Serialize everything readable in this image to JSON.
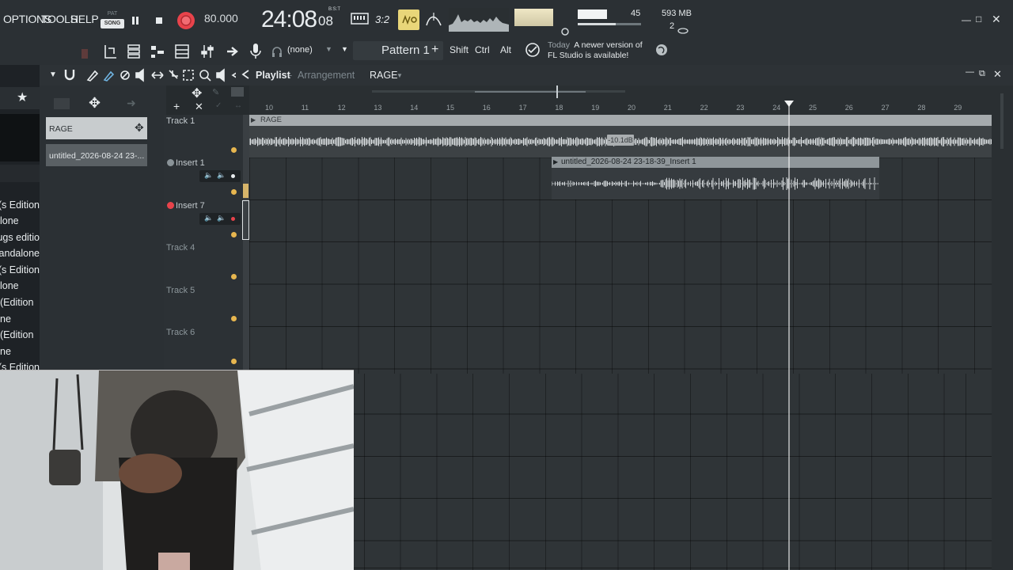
{
  "menu": {
    "options": "OPTIONS",
    "tools": "TOOLS",
    "help": "HELP"
  },
  "transport": {
    "mode_pat": "PAT",
    "mode_song": "SONG",
    "tempo": "80.000",
    "time_main": "24:08",
    "time_sub": "08",
    "time_label": "B:S:T",
    "snap_label": "3:2"
  },
  "monitor": {
    "cpu": "45",
    "memory": "593 MB",
    "polyphony": "2"
  },
  "toolbar2": {
    "channel_selector": "(none)",
    "pattern": "Pattern 1",
    "keys": [
      "Shift",
      "Ctrl",
      "Alt"
    ],
    "news_today": "Today",
    "news_text_1": "A newer version of",
    "news_text_2": "FL Studio is available!"
  },
  "browser": {
    "items": [
      "s Edition)",
      "lone",
      "ugs editio",
      "andalone",
      "s Edition)",
      "lone",
      "Edition)",
      "ne",
      "Edition)",
      "ne",
      "s Edition)"
    ]
  },
  "playlist": {
    "title": "Playlist",
    "subtitle": "Arrangement",
    "arrangement_name": "RAGE",
    "clips_list": [
      "RAGE",
      "untitled_2026-08-24 23-..."
    ],
    "tracks": [
      "Track 1",
      "Insert 1",
      "Insert 7",
      "Track 4",
      "Track 5",
      "Track 6"
    ],
    "ruler": [
      "10",
      "11",
      "12",
      "13",
      "14",
      "15",
      "16",
      "17",
      "18",
      "19",
      "20",
      "21",
      "22",
      "23",
      "24",
      "25",
      "26",
      "27",
      "28",
      "29"
    ],
    "clip1_name": "RAGE",
    "clip1_gain": "-10.1dB",
    "clip2_name": "untitled_2026-08-24 23-18-39_Insert 1"
  },
  "colors": {
    "record": "#e8434b",
    "accent": "#e7b64f",
    "background": "#262b2e"
  }
}
